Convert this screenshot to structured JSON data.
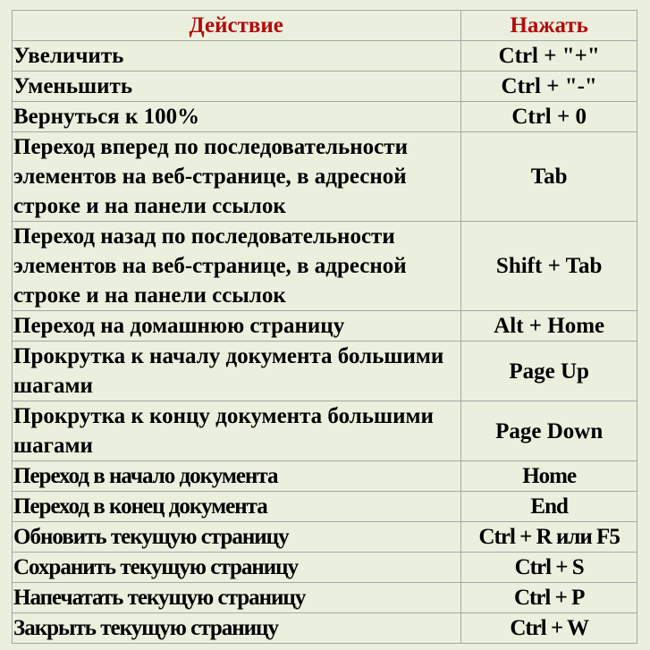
{
  "table": {
    "headers": {
      "action": "Действие",
      "press": "Нажать"
    },
    "header_color": "#b30c0c",
    "background": "#ebf0de",
    "rows": [
      {
        "action": "Увеличить",
        "keys": "Ctrl + \"+\""
      },
      {
        "action": "Уменьшить",
        "keys": "Ctrl + \"-\""
      },
      {
        "action": "Вернуться к 100%",
        "keys": "Ctrl + 0"
      },
      {
        "action": "Переход вперед по последовательности элементов на веб-странице, в адресной строке и на панели ссылок",
        "keys": "Tab"
      },
      {
        "action": "Переход назад по последовательности элементов на веб-странице, в адресной строке и на панели ссылок",
        "keys": "Shift + Tab"
      },
      {
        "action": "Переход на домашнюю страницу",
        "keys": "Alt + Home"
      },
      {
        "action": "Прокрутка к началу документа большими шагами",
        "keys": "Page Up"
      },
      {
        "action": "Прокрутка к концу документа большими шагами",
        "keys": "Page Down"
      },
      {
        "action": "Переход в начало документа",
        "keys": "Home"
      },
      {
        "action": "Переход в конец документа",
        "keys": "End"
      },
      {
        "action": "Обновить текущую страницу",
        "keys": "Ctrl + R или F5"
      },
      {
        "action": "Сохранить текущую страницу",
        "keys": "Ctrl + S"
      },
      {
        "action": "Напечатать текущую страницу",
        "keys": "Ctrl + P"
      },
      {
        "action": "Закрыть текущую страницу",
        "keys": "Ctrl + W"
      }
    ]
  }
}
